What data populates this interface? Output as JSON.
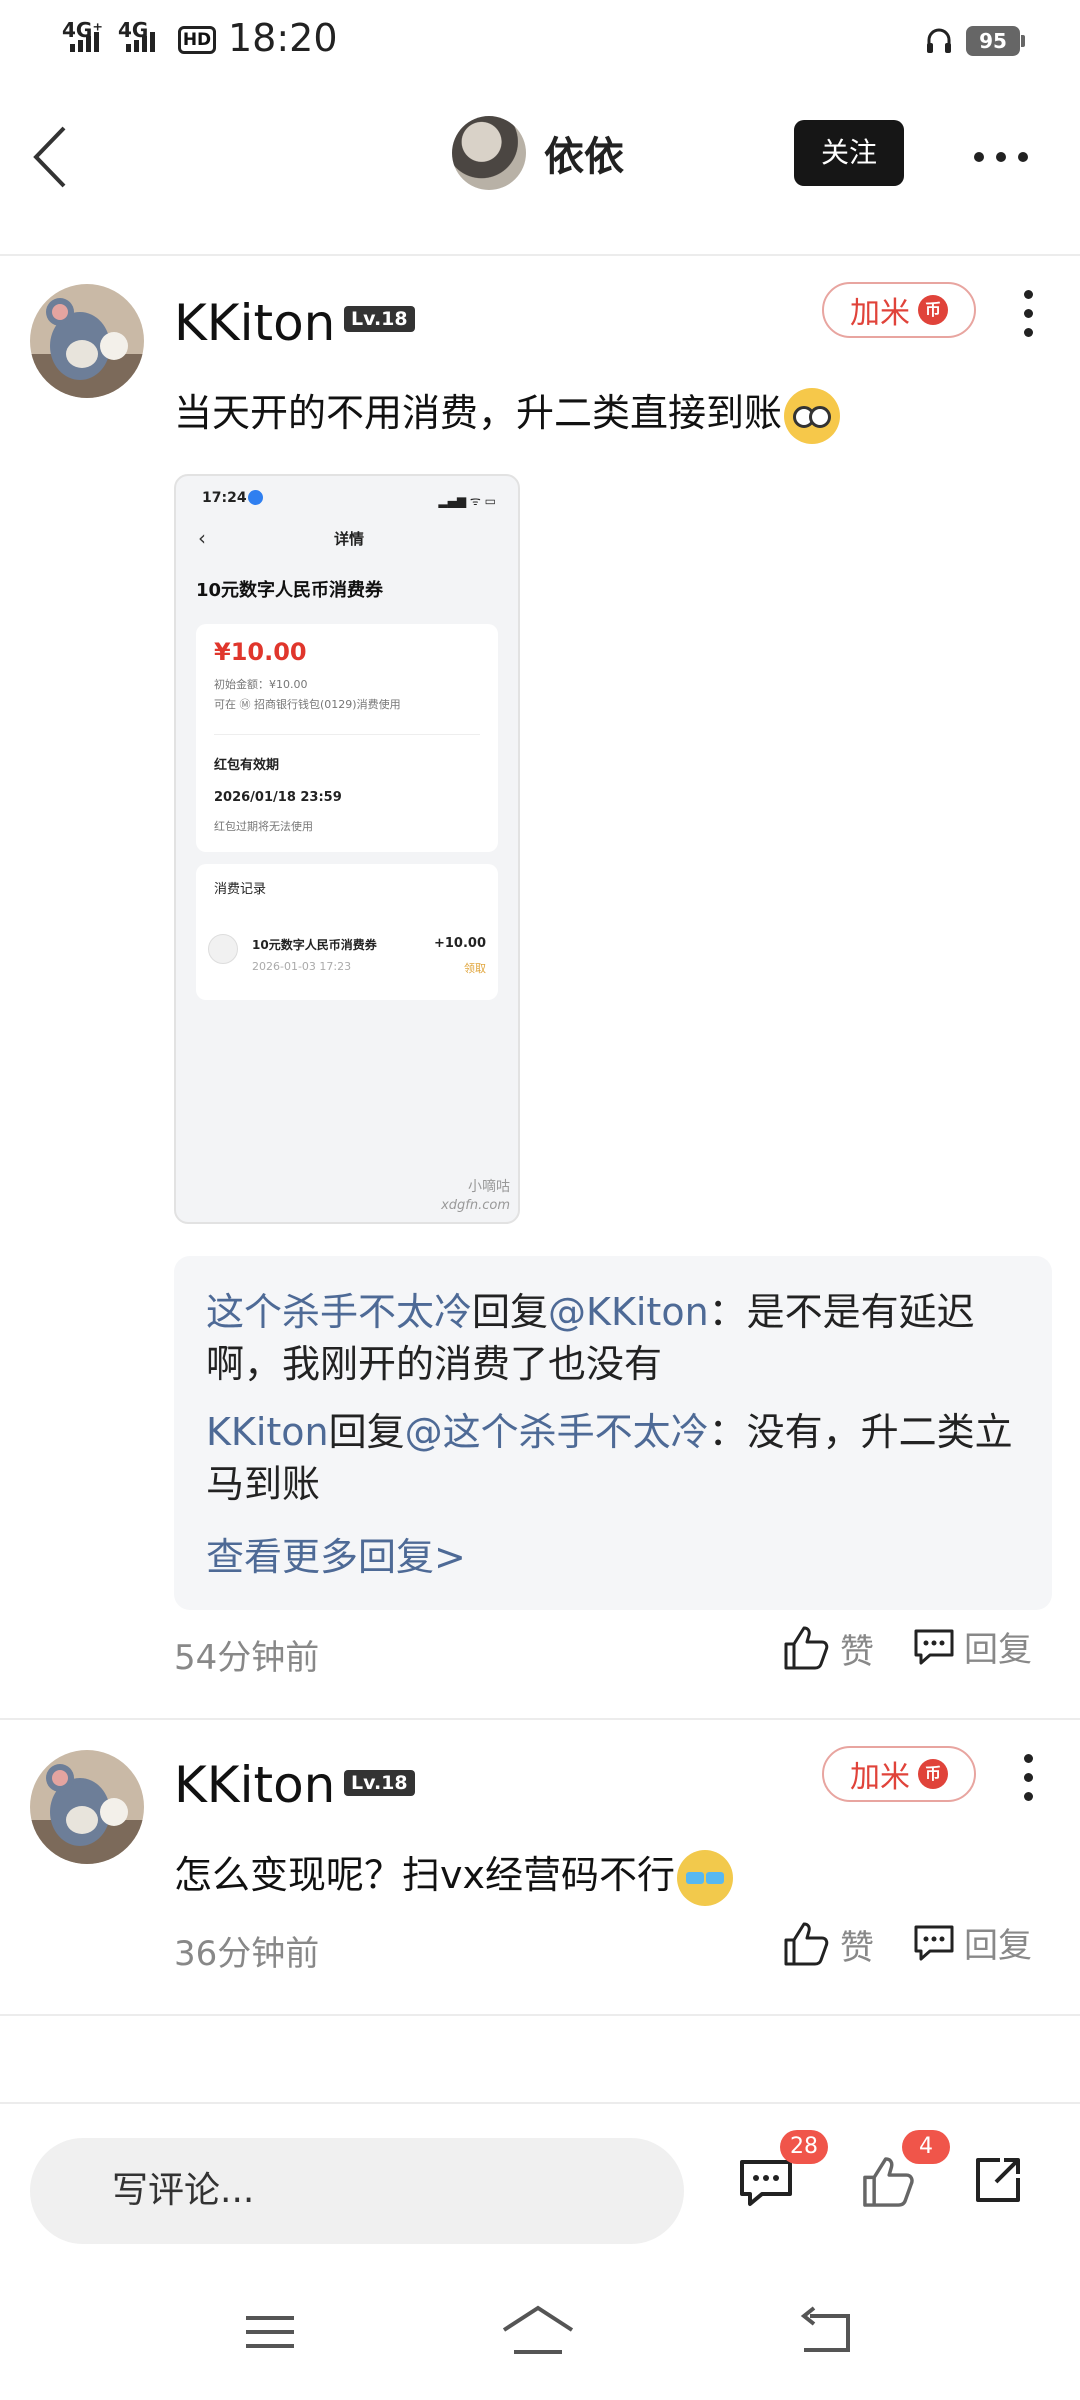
{
  "status_bar": {
    "sig1": "4G⁺",
    "sig2": "4G",
    "hd": "HD",
    "time": "18:20",
    "battery": "95"
  },
  "header": {
    "username": "依依",
    "follow_label": "关注"
  },
  "comments": [
    {
      "username": "KKiton",
      "level": "Lv.18",
      "jiami_label": "加米",
      "coin": "币",
      "text": "当天开的不用消费，升二类直接到账",
      "time": "54分钟前",
      "like_label": "赞",
      "reply_label": "回复",
      "attached_screenshot": {
        "status_time": "17:24",
        "page_title": "详情",
        "heading": "10元数字人民币消费券",
        "amount": "¥10.00",
        "initial": "初始金额：¥10.00",
        "usable_at": "可在 Ⓜ 招商银行钱包(0129)消费使用",
        "validity_label": "红包有效期",
        "validity_date": "2026/01/18 23:59",
        "expiry_note": "红包过期将无法使用",
        "records_label": "消费记录",
        "record_name": "10元数字人民币消费券",
        "record_date": "2026-01-03 17:23",
        "record_amount": "+10.00",
        "record_tag": "领取",
        "watermark1": "小嘀咕",
        "watermark2": "xdgfn.com"
      },
      "replies": [
        {
          "from": "这个杀手不太冷",
          "verb": "回复",
          "to": "@KKiton",
          "text": "：是不是有延迟啊，我刚开的消费了也没有"
        },
        {
          "from": "KKiton",
          "verb": "回复",
          "to": "@这个杀手不太冷",
          "text": "：没有，升二类立马到账"
        }
      ],
      "more_replies": "查看更多回复>"
    },
    {
      "username": "KKiton",
      "level": "Lv.18",
      "jiami_label": "加米",
      "coin": "币",
      "text": "怎么变现呢？扫vx经营码不行",
      "time": "36分钟前",
      "like_label": "赞",
      "reply_label": "回复"
    }
  ],
  "bottom_bar": {
    "placeholder": "写评论...",
    "comment_count": "28",
    "like_count": "4"
  },
  "icons": [
    "back-icon",
    "more-icon",
    "kebab-icon",
    "thumb-up-icon",
    "reply-bubble-icon",
    "comment-icon",
    "like-icon",
    "share-icon",
    "menu-icon",
    "home-icon",
    "return-icon"
  ],
  "colors": {
    "accent_red": "#e0433a",
    "link_blue": "#4e6a96",
    "badge_red": "#f0554a"
  }
}
